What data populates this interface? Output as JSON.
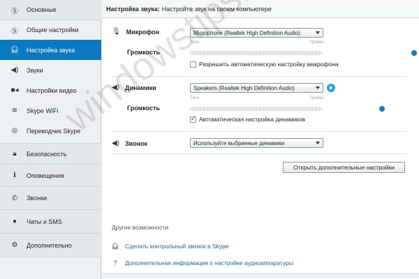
{
  "sidebar": {
    "groups": [
      {
        "label": "Основные",
        "icon": "skype-icon"
      },
      {
        "label": "Безопасность",
        "icon": "lock-icon"
      },
      {
        "label": "Оповещения",
        "icon": "info-icon"
      },
      {
        "label": "Звонки",
        "icon": "phone-icon"
      },
      {
        "label": "Чаты и SMS",
        "icon": "chat-icon"
      },
      {
        "label": "Дополнительно",
        "icon": "gear-icon"
      }
    ],
    "items": [
      {
        "label": "Общие настройки",
        "icon": "skype-icon"
      },
      {
        "label": "Настройка звука",
        "icon": "headset-icon",
        "active": true
      },
      {
        "label": "Звуки",
        "icon": "speaker-icon"
      },
      {
        "label": "Настройки видео",
        "icon": "camera-icon"
      },
      {
        "label": "Skype WiFi",
        "icon": "wifi-icon"
      },
      {
        "label": "Переводчик Skype",
        "icon": "translator-icon"
      }
    ]
  },
  "header": {
    "title": "Настройка звука:",
    "subtitle": "Настройте звук на своем компьютере"
  },
  "microphone": {
    "label": "Микрофон",
    "device": "Microphone (Realtek High Definition Audio)",
    "volume_label": "Громкость",
    "quiet": "Тихо",
    "loud": "Громко",
    "volume_level": 0.92,
    "auto_label": "Разрешить автоматическую настройку микрофона",
    "auto_checked": false
  },
  "speakers": {
    "label": "Динамики",
    "device": "Speakers (Realtek High Definition Audio)",
    "volume_label": "Громкость",
    "quiet": "Тихо",
    "loud": "Громко",
    "volume_level": 0.68,
    "auto_label": "Автоматическая настройка динамиков",
    "auto_checked": true
  },
  "ringer": {
    "label": "Звонок",
    "device": "Используйте выбранные динамики"
  },
  "advanced_button": "Открыть дополнительные настройки",
  "other": {
    "title": "Другие возможности",
    "links": [
      {
        "label": "Сделать контрольный звонок в Skype",
        "icon": "headset-icon"
      },
      {
        "label": "Дополнительная информация о настройке аудиоаппаратуры",
        "icon": "help-icon"
      }
    ]
  },
  "watermark": "windowstips.ru",
  "colors": {
    "accent": "#0b7ac2",
    "link": "#1c5fa8"
  }
}
